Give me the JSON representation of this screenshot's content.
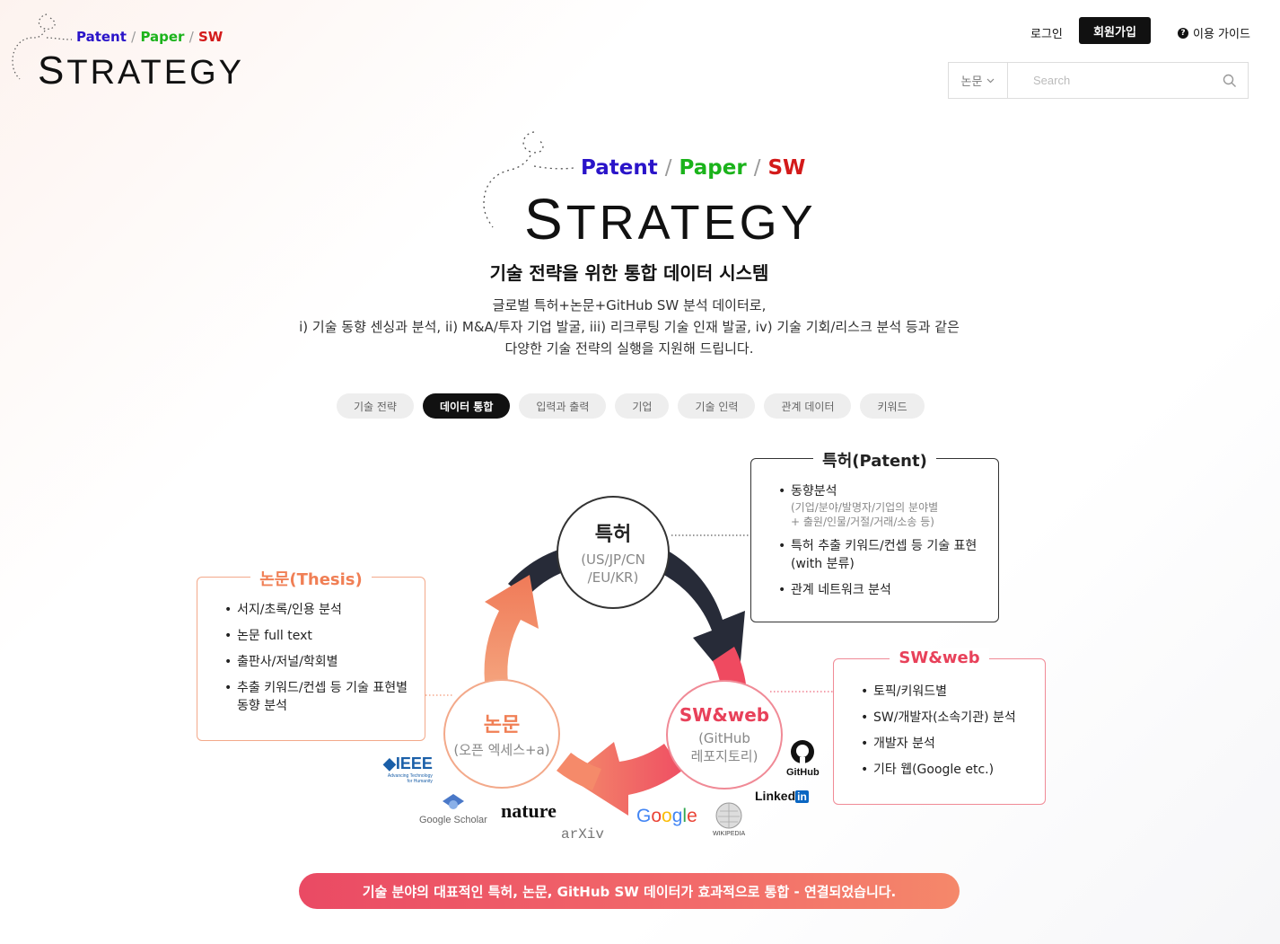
{
  "header": {
    "logo": {
      "patent": "Patent",
      "paper": "Paper",
      "sw": "SW",
      "slash": "/",
      "cap": "S",
      "rest": "TRATEGY"
    },
    "login": "로그인",
    "signup": "회원가입",
    "guide": "이용 가이드",
    "guide_icon": "?",
    "search": {
      "select_value": "논문",
      "placeholder": "Search"
    }
  },
  "hero": {
    "title": "기술 전략을 위한 통합 데이터 시스템",
    "desc_lines": [
      "글로벌 특허+논문+GitHub SW 분석 데이터로,",
      "i) 기술 동향 센싱과 분석, ii) M&A/투자 기업 발굴, iii) 리크루팅 기술 인재 발굴, iv) 기술 기회/리스크 분석 등과 같은",
      "다양한 기술 전략의 실행을 지원해 드립니다."
    ]
  },
  "tabs": [
    "기술 전략",
    "데이터 통합",
    "입력과 출력",
    "기업",
    "기술 인력",
    "관계 데이터",
    "키워드"
  ],
  "active_tab": "데이터 통합",
  "diagram": {
    "patent_circle": {
      "title": "특허",
      "line1": "(US/JP/CN",
      "line2": "/EU/KR)"
    },
    "thesis_circle": {
      "title": "논문",
      "line1": "(오픈 엑세스+a)"
    },
    "sw_circle": {
      "title": "SW&web",
      "line1": "(GitHub",
      "line2": "레포지토리)"
    },
    "patent_box": {
      "title": "특허(Patent)",
      "items": [
        {
          "text": "동향분석",
          "sub1": "(기업/분야/발명자/기업의 분야별",
          "sub2": "+ 출원/인물/거절/거래/소송 등)"
        },
        {
          "text": "특허 추출 키워드/컨셉 등 기술 표현",
          "text2": "(with 분류)"
        },
        {
          "text": "관계 네트워크 분석"
        }
      ]
    },
    "thesis_box": {
      "title": "논문(Thesis)",
      "items": [
        "서지/초록/인용 분석",
        "논문 full text",
        "출판사/저널/학회별",
        "추출 키워드/컨셉 등 기술 표현별",
        "동향 분석"
      ]
    },
    "sw_box": {
      "title": "SW&web",
      "items": [
        "토픽/키워드별",
        "SW/개발자(소속기관) 분석",
        "개발자 분석",
        "기타 웹(Google etc.)"
      ]
    },
    "sources": {
      "ieee": "IEEE",
      "ieee_tag1": "Advancing Technology",
      "ieee_tag2": "for Humanity",
      "gscholar": "Google Scholar",
      "nature": "nature",
      "arxiv": "arXiv",
      "google": [
        "G",
        "o",
        "o",
        "g",
        "l",
        "e"
      ],
      "wiki": "WIKIPEDIA",
      "github": "GitHub",
      "linkedin": "Linked",
      "linkedin_in": "in"
    },
    "colors": {
      "patent": "#2a2f3e",
      "thesis": "#f07f55",
      "sw": "#e8415a"
    }
  },
  "banner": "기술 분야의 대표적인 특허, 논문, GitHub SW 데이터가 효과적으로 통합 - 연결되었습니다."
}
